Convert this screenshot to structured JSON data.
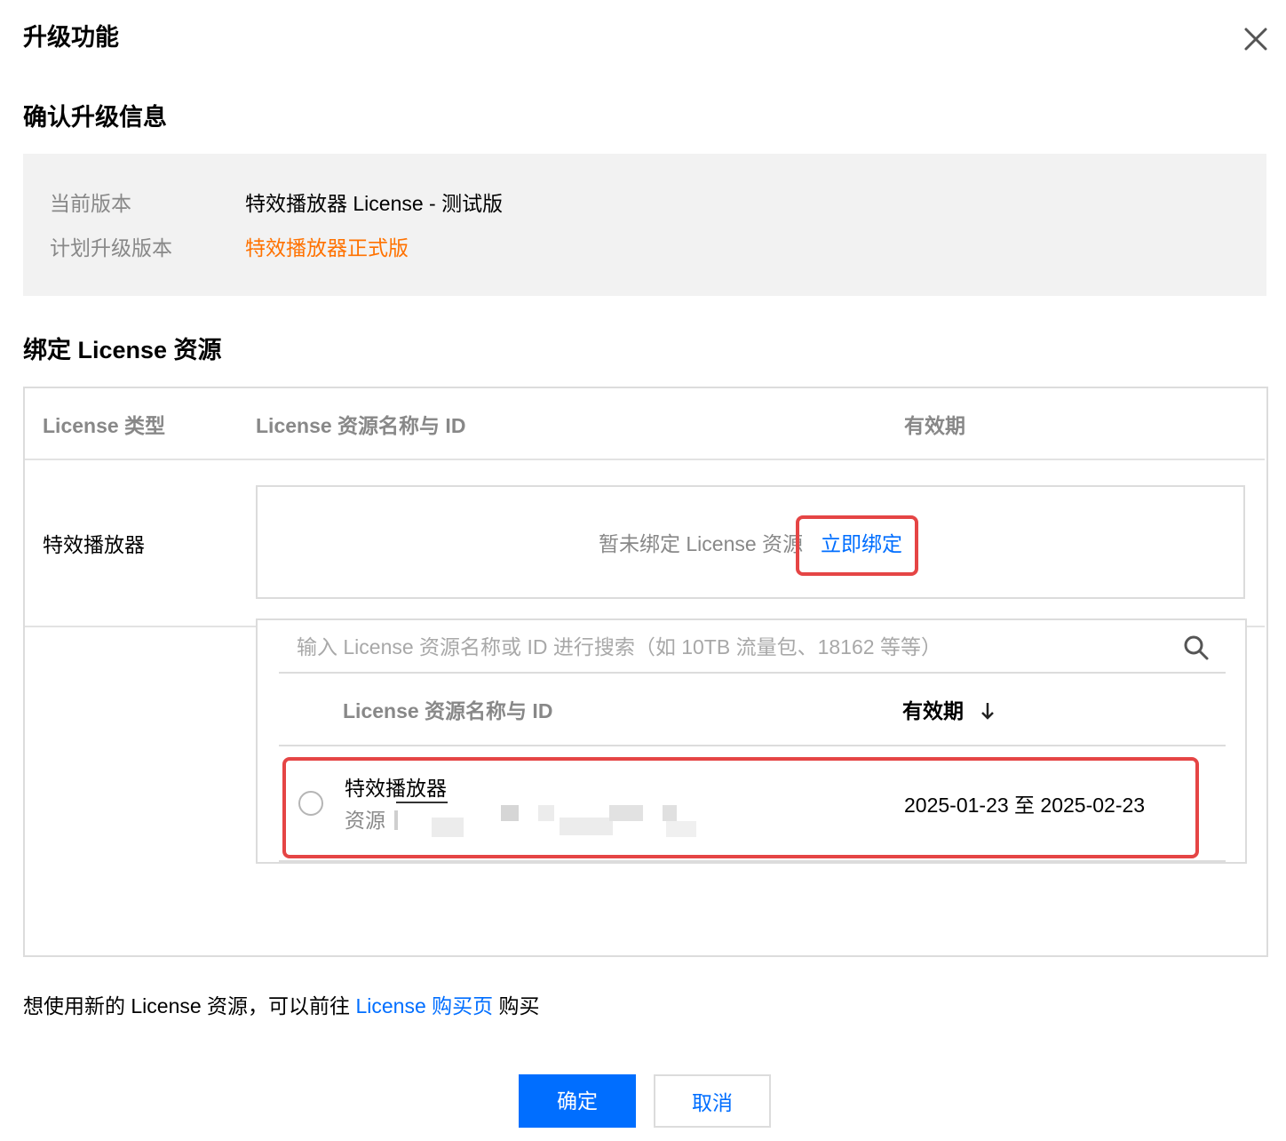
{
  "dialog": {
    "title": "升级功能"
  },
  "confirm_section": {
    "title": "确认升级信息",
    "current_version_label": "当前版本",
    "current_version_value": "特效播放器 License - 测试版",
    "planned_version_label": "计划升级版本",
    "planned_version_value": "特效播放器正式版"
  },
  "bind_section": {
    "title": "绑定 License 资源",
    "columns": [
      "License 类型",
      "License 资源名称与 ID",
      "有效期"
    ],
    "row_type": "特效播放器",
    "empty_text": "暂未绑定 License 资",
    "empty_text_tail": "源",
    "bind_now_label": "立即绑定"
  },
  "dropdown": {
    "search_placeholder": "输入 License 资源名称或 ID 进行搜索（如 10TB 流量包、18162 等等）",
    "columns": [
      "License 资源名称与 ID",
      "有效期"
    ],
    "sort_icon": "arrow-down-icon",
    "items": [
      {
        "name": "特效播放器",
        "sub_label": "资源",
        "validity": "2025-01-23 至 2025-02-23"
      }
    ]
  },
  "footer": {
    "note_prefix": "想使用新的 License 资源，可以前往",
    "note_link": "License 购买页",
    "note_suffix": "购买"
  },
  "buttons": {
    "confirm": "确定",
    "cancel": "取消"
  },
  "colors": {
    "primary": "#006eff",
    "accent": "#ff7200",
    "highlight": "#e54545"
  }
}
